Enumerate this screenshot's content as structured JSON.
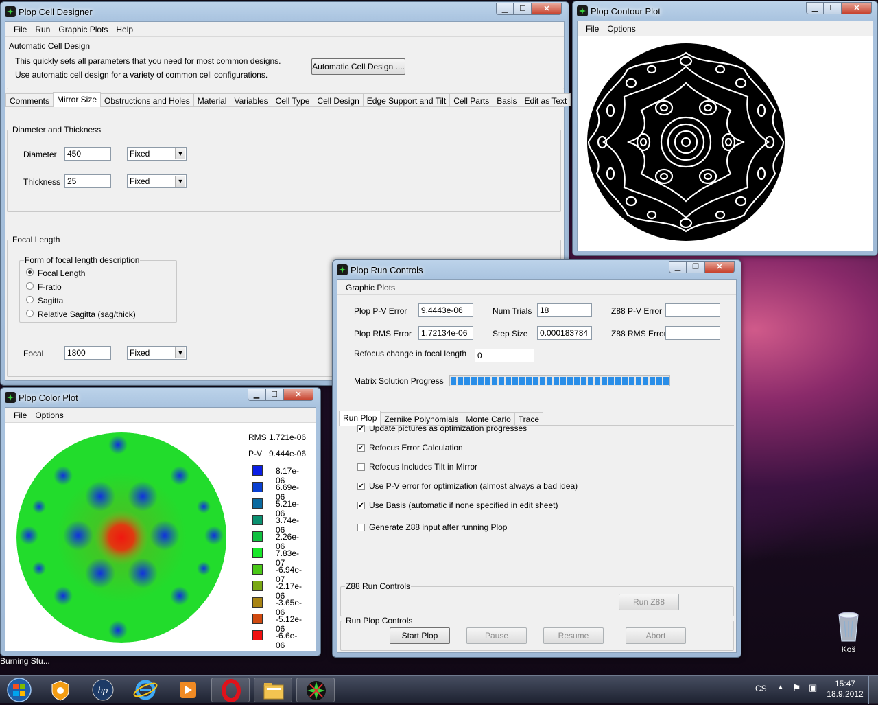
{
  "cell_designer": {
    "title": "Plop Cell Designer",
    "menu": [
      "File",
      "Run",
      "Graphic Plots",
      "Help"
    ],
    "auto_group": "Automatic Cell Design",
    "auto_line1": "This quickly sets all parameters that you need for most common designs.",
    "auto_line2": "Use automatic cell design for a variety of common cell configurations.",
    "auto_button": "Automatic Cell Design ....",
    "tabs": [
      "Comments",
      "Mirror Size",
      "Obstructions and Holes",
      "Material",
      "Variables",
      "Cell Type",
      "Cell Design",
      "Edge Support and Tilt",
      "Cell Parts",
      "Basis",
      "Edit as Text"
    ],
    "dt_group": "Diameter and Thickness",
    "diameter_label": "Diameter",
    "diameter_value": "450",
    "diameter_mode": "Fixed",
    "thickness_label": "Thickness",
    "thickness_value": "25",
    "thickness_mode": "Fixed",
    "fl_group": "Focal Length",
    "form_group": "Form of focal length description",
    "radios": [
      "Focal Length",
      "F-ratio",
      "Sagitta",
      "Relative Sagitta (sag/thick)"
    ],
    "focal_label": "Focal",
    "focal_value": "1800",
    "focal_mode": "Fixed"
  },
  "contour_plot": {
    "title": "Plop Contour Plot",
    "menu": [
      "File",
      "Options"
    ]
  },
  "color_plot": {
    "title": "Plop Color Plot",
    "menu": [
      "File",
      "Options"
    ],
    "rms_label": "RMS",
    "rms_value": "1.721e-06",
    "pv_label": "P-V",
    "pv_value": "9.444e-06",
    "legend": [
      {
        "color": "#0a1ee6",
        "value": "8.17e-06"
      },
      {
        "color": "#0a40d2",
        "value": "6.69e-06"
      },
      {
        "color": "#0a6aa0",
        "value": "5.21e-06"
      },
      {
        "color": "#0a9070",
        "value": "3.74e-06"
      },
      {
        "color": "#10c040",
        "value": "2.26e-06"
      },
      {
        "color": "#18e82a",
        "value": "7.83e-07"
      },
      {
        "color": "#4ac818",
        "value": "-6.94e-07"
      },
      {
        "color": "#7aa814",
        "value": "-2.17e-06"
      },
      {
        "color": "#a88414",
        "value": "-3.65e-06"
      },
      {
        "color": "#d04a10",
        "value": "-5.12e-06"
      },
      {
        "color": "#f01010",
        "value": "-6.6e-06"
      }
    ]
  },
  "run_controls": {
    "title": "Plop Run Controls",
    "menu": [
      "Graphic Plots"
    ],
    "pv_error_label": "Plop P-V Error",
    "pv_error_value": "9.4443e-06",
    "num_trials_label": "Num Trials",
    "num_trials_value": "18",
    "z88_pv_label": "Z88 P-V Error",
    "z88_pv_value": "",
    "rms_error_label": "Plop RMS Error",
    "rms_error_value": "1.72134e-06",
    "step_size_label": "Step Size",
    "step_size_value": "0.000183784",
    "z88_rms_label": "Z88 RMS Error",
    "z88_rms_value": "",
    "refocus_label": "Refocus change in focal length",
    "refocus_value": "0",
    "progress_label": "Matrix Solution Progress",
    "progress_fraction": 1.0,
    "tabs": [
      "Run Plop",
      "Zernike Polynomials",
      "Monte Carlo",
      "Trace"
    ],
    "checks": [
      {
        "label": "Update pictures as optimization progresses",
        "checked": true
      },
      {
        "label": "Refocus Error Calculation",
        "checked": true
      },
      {
        "label": "Refocus Includes Tilt in Mirror",
        "checked": false
      },
      {
        "label": "Use P-V error for optimization (almost always a bad idea)",
        "checked": true
      },
      {
        "label": "Use Basis (automatic if none specified in edit sheet)",
        "checked": true
      },
      {
        "label": "Generate Z88 input after running Plop",
        "checked": false
      }
    ],
    "z88_group": "Z88 Run Controls",
    "run_z88": "Run Z88",
    "plop_group": "Run Plop Controls",
    "start": "Start Plop",
    "pause": "Pause",
    "resume": "Resume",
    "abort": "Abort"
  },
  "desktop": {
    "recycle_label": "Koš",
    "status_text": "Burning Stu..."
  },
  "taskbar": {
    "lang": "CS",
    "time": "15:47",
    "date": "18.9.2012",
    "icons": [
      "windows-start-icon",
      "avast-icon",
      "hp-icon",
      "internet-explorer-icon",
      "media-player-icon",
      "opera-icon",
      "file-explorer-icon",
      "plop-icon"
    ]
  }
}
